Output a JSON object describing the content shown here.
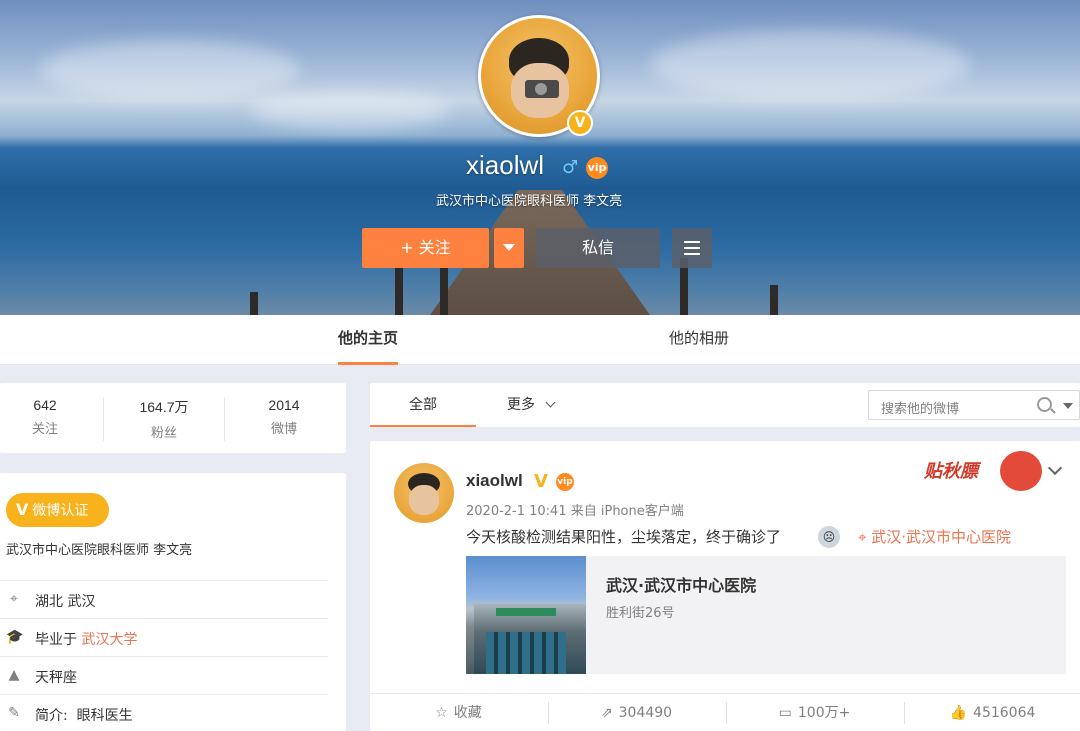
{
  "profile": {
    "username": "xiaolwl",
    "subtitle": "武汉市中心医院眼科医师 李文亮",
    "follow_label": "+ 关注",
    "message_label": "私信",
    "verified_badge": "V",
    "vip_badge": "vip",
    "gender_icon": "male-icon"
  },
  "tabs": [
    {
      "label": "他的主页",
      "active": true
    },
    {
      "label": "他的相册",
      "active": false
    }
  ],
  "stats": [
    {
      "num": "642",
      "label": "关注"
    },
    {
      "num": "164.7万",
      "label": "粉丝"
    },
    {
      "num": "2014",
      "label": "微博"
    }
  ],
  "info": {
    "verify_label": "微博认证",
    "title": "武汉市中心医院眼科医师 李文亮",
    "location": "湖北 武汉",
    "edu_prefix": "毕业于",
    "edu_school": "武汉大学",
    "zodiac": "天秤座",
    "bio_label": "简介:",
    "bio_value": "眼科医生"
  },
  "feed_tabs": {
    "all": "全部",
    "more": "更多",
    "search_placeholder": "搜索他的微博"
  },
  "post": {
    "author": "xiaolwl",
    "meta": "2020-2-1 10:41 来自 iPhone客户端",
    "text": "今天核酸检测结果阳性，尘埃落定，终于确诊了",
    "location": "武汉·武汉市中心医院",
    "sticker_text": "贴秋膘",
    "card_title": "武汉·武汉市中心医院",
    "card_sub": "胜利街26号",
    "actions": {
      "favorite": "收藏",
      "repost": "304490",
      "comment": "100万+",
      "like": "4516064"
    }
  },
  "colors": {
    "accent": "#ff8140",
    "link": "#eb7350",
    "verified": "#f7b21c"
  }
}
